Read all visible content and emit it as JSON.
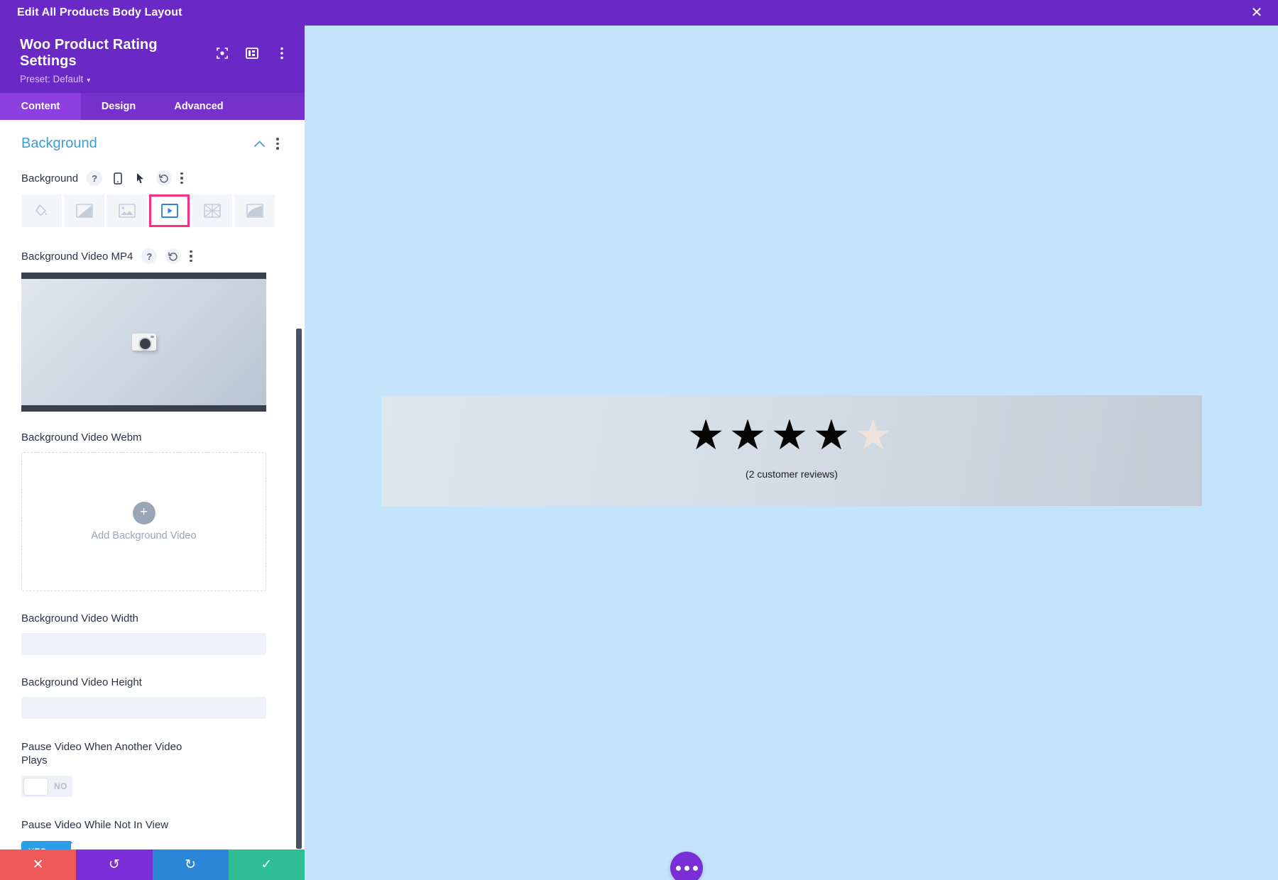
{
  "topbar": {
    "title": "Edit All Products Body Layout",
    "close_icon": "close-icon"
  },
  "panel": {
    "title": "Woo Product Rating Settings",
    "preset_label": "Preset: Default",
    "header_icons": [
      "target-icon",
      "layout-columns-icon",
      "more-vertical-icon"
    ],
    "tabs": [
      {
        "label": "Content",
        "active": true
      },
      {
        "label": "Design",
        "active": false
      },
      {
        "label": "Advanced",
        "active": false
      }
    ],
    "section": {
      "title": "Background",
      "collapse_icon": "chevron-up-icon",
      "more_icon": "more-vertical-icon"
    },
    "background_field": {
      "label": "Background",
      "help_icon": "question-mark-icon",
      "responsive_icon": "mobile-icon",
      "hover_icon": "cursor-icon",
      "reset_icon": "undo-icon",
      "more_icon": "more-vertical-icon",
      "types": [
        {
          "name": "background-color",
          "glyph": "paint-bucket-icon",
          "selected": false
        },
        {
          "name": "background-gradient",
          "glyph": "gradient-icon",
          "selected": false
        },
        {
          "name": "background-image",
          "glyph": "image-icon",
          "selected": false
        },
        {
          "name": "background-video",
          "glyph": "video-icon",
          "selected": true
        },
        {
          "name": "background-pattern",
          "glyph": "pattern-icon",
          "selected": false
        },
        {
          "name": "background-mask",
          "glyph": "mask-icon",
          "selected": false
        }
      ],
      "selected_highlight_color": "#ff2b84"
    },
    "video_mp4": {
      "label": "Background Video MP4",
      "help_icon": "question-mark-icon",
      "reset_icon": "undo-icon",
      "more_icon": "more-vertical-icon",
      "thumbnail_alt": "video-thumbnail"
    },
    "video_webm": {
      "label": "Background Video Webm",
      "upload_label": "Add Background Video",
      "upload_icon": "plus-icon"
    },
    "video_width": {
      "label": "Background Video Width",
      "value": "",
      "placeholder": ""
    },
    "video_height": {
      "label": "Background Video Height",
      "value": "",
      "placeholder": ""
    },
    "pause_when_another": {
      "label": "Pause Video When Another Video Plays",
      "state": "NO",
      "on": false
    },
    "pause_not_in_view": {
      "label": "Pause Video While Not In View",
      "state": "YES",
      "on": true
    },
    "scrollbar": "panel-scrollbar"
  },
  "actions": [
    {
      "name": "cancel-button",
      "icon": "✕"
    },
    {
      "name": "undo-button",
      "icon": "↺"
    },
    {
      "name": "redo-button",
      "icon": "↻"
    },
    {
      "name": "save-button",
      "icon": "✓"
    }
  ],
  "canvas": {
    "rating": {
      "stars_filled": 4,
      "stars_total": 5,
      "filled_glyph": "★",
      "empty_glyph": "★",
      "reviews_text": "(2 customer reviews)"
    },
    "fab": {
      "name": "page-settings-button",
      "icon": "more-horizontal-icon"
    },
    "background_color": "#c3e4fb"
  }
}
